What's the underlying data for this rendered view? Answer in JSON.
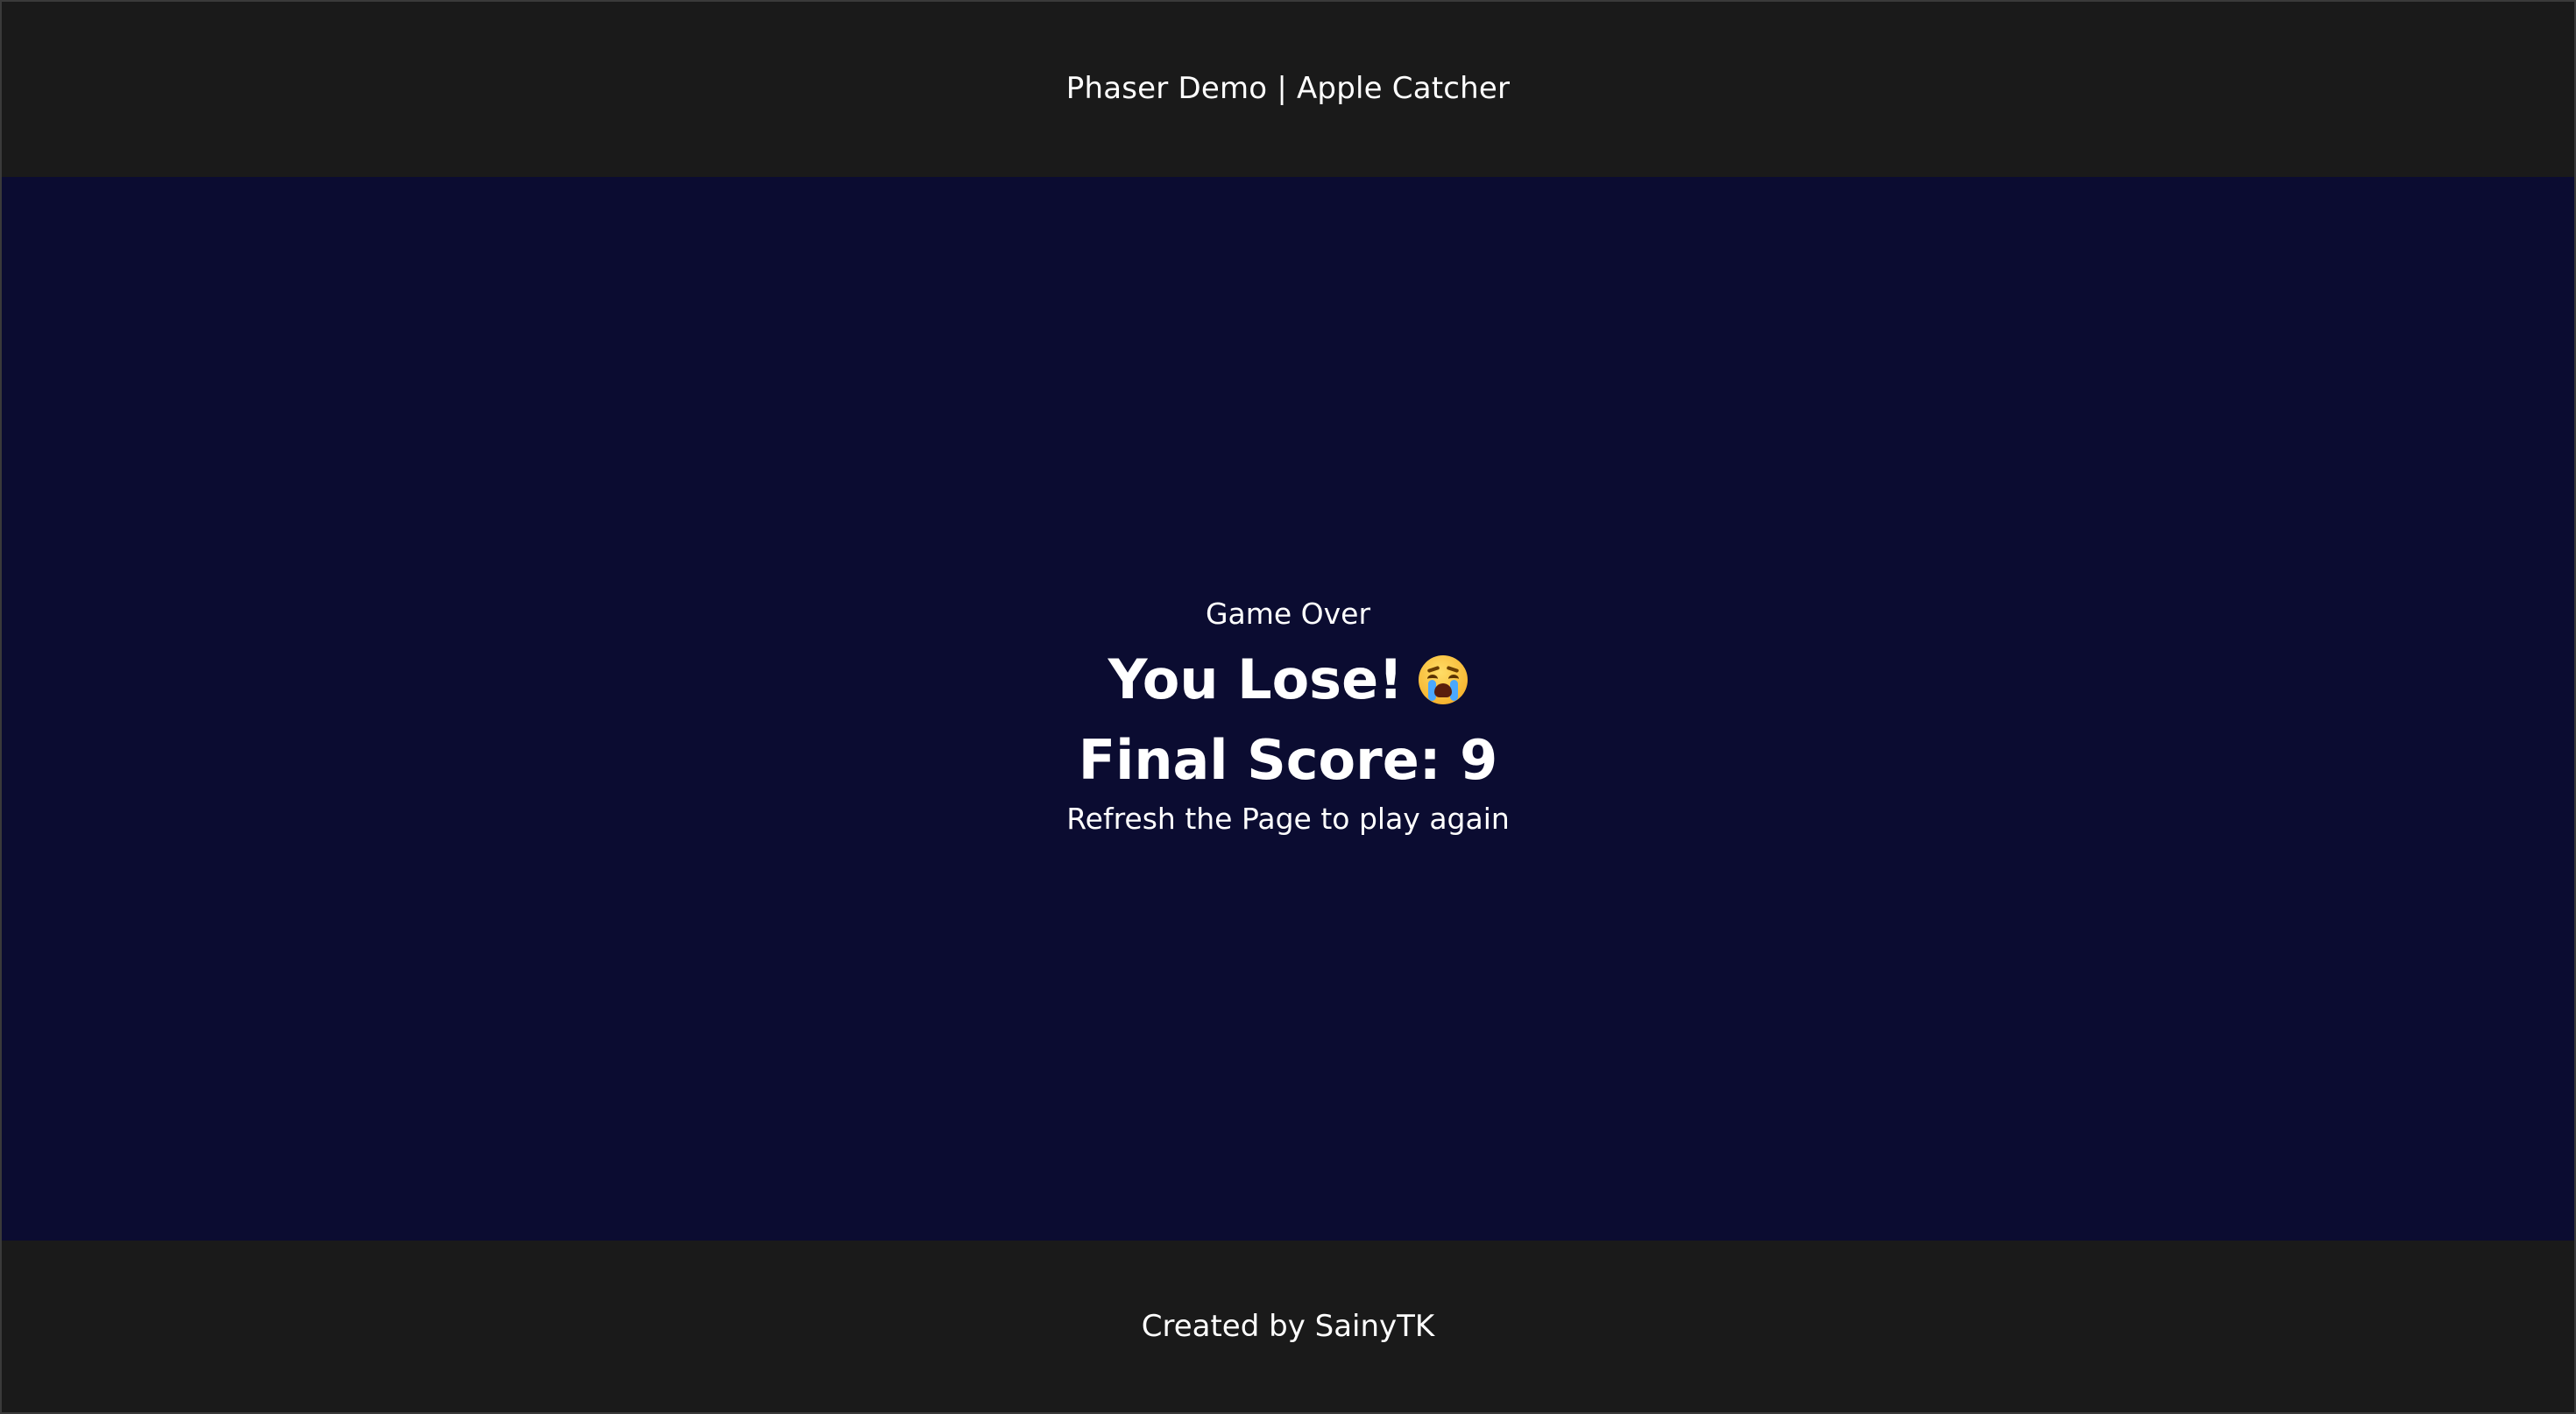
{
  "header": {
    "title": "Phaser Demo | Apple Catcher"
  },
  "game": {
    "status": "Game Over",
    "result": "You Lose!",
    "result_icon": "crying-face-emoji",
    "final_score_text": "Final Score: 9",
    "hint": "Refresh the Page to play again"
  },
  "footer": {
    "credit": "Created by SainyTK"
  },
  "colors": {
    "chrome": "#1a1a1a",
    "canvas": "#0b0c31",
    "text": "#ffffff"
  }
}
